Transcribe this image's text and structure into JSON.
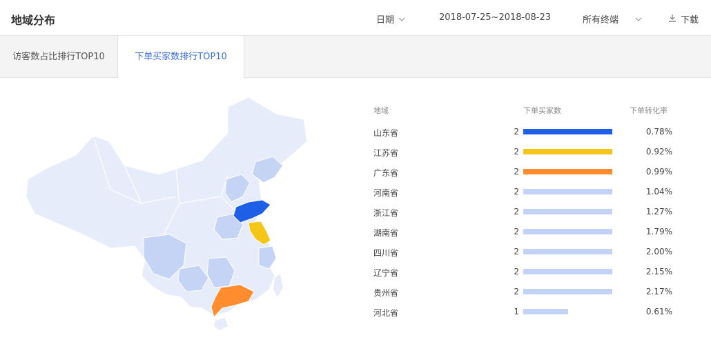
{
  "header": {
    "title": "地域分布",
    "date_label": "日期",
    "date_range": "2018-07-25~2018-08-23",
    "terminal_label": "所有终端",
    "download_label": "下载"
  },
  "tabs": [
    {
      "label": "访客数占比排行TOP10",
      "active": false
    },
    {
      "label": "下单买家数排行TOP10",
      "active": true
    }
  ],
  "ranking": {
    "columns": [
      "地域",
      "下单买家数",
      "下单转化率"
    ],
    "max_value": 2,
    "rows": [
      {
        "region": "山东省",
        "value": 2,
        "rate": "0.78%",
        "color": "#1f5ee6"
      },
      {
        "region": "江苏省",
        "value": 2,
        "rate": "0.92%",
        "color": "#f5c518"
      },
      {
        "region": "广东省",
        "value": 2,
        "rate": "0.99%",
        "color": "#ff8c2e"
      },
      {
        "region": "河南省",
        "value": 2,
        "rate": "1.04%",
        "color": "#c2d3f7"
      },
      {
        "region": "浙江省",
        "value": 2,
        "rate": "1.27%",
        "color": "#c2d3f7"
      },
      {
        "region": "湖南省",
        "value": 2,
        "rate": "1.79%",
        "color": "#c2d3f7"
      },
      {
        "region": "四川省",
        "value": 2,
        "rate": "2.00%",
        "color": "#c2d3f7"
      },
      {
        "region": "辽宁省",
        "value": 2,
        "rate": "2.15%",
        "color": "#c2d3f7"
      },
      {
        "region": "贵州省",
        "value": 2,
        "rate": "2.17%",
        "color": "#c2d3f7"
      },
      {
        "region": "河北省",
        "value": 1,
        "rate": "0.61%",
        "color": "#c2d3f7"
      }
    ]
  },
  "map_colors": {
    "base": "#e6ecfa",
    "mid": "#c5d4f5",
    "top1": "#1f5ee6",
    "top2": "#f5c518",
    "top3": "#ff8c2e"
  }
}
